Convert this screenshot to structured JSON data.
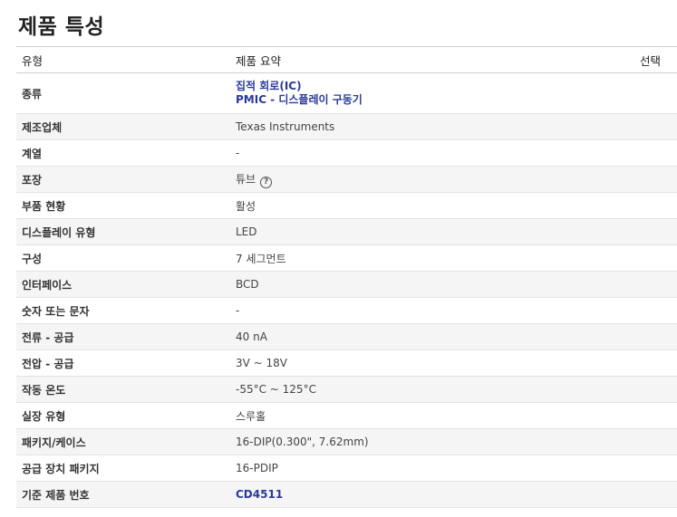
{
  "title": "제품 특성",
  "header": {
    "type": "유형",
    "summary": "제품 요약",
    "select": "선택"
  },
  "rows": [
    {
      "label": "종류",
      "value": "",
      "links": [
        "집적 회로(IC)",
        "PMIC - 디스플레이 구동기"
      ]
    },
    {
      "label": "제조업체",
      "value": "Texas Instruments"
    },
    {
      "label": "계열",
      "value": "-"
    },
    {
      "label": "포장",
      "value": "튜브",
      "help": "?"
    },
    {
      "label": "부품 현황",
      "value": "활성"
    },
    {
      "label": "디스플레이 유형",
      "value": "LED"
    },
    {
      "label": "구성",
      "value": "7 세그먼트"
    },
    {
      "label": "인터페이스",
      "value": "BCD"
    },
    {
      "label": "숫자 또는 문자",
      "value": "-"
    },
    {
      "label": "전류 - 공급",
      "value": "40 nA"
    },
    {
      "label": "전압 - 공급",
      "value": "3V ~ 18V"
    },
    {
      "label": "작동 온도",
      "value": "-55°C ~ 125°C"
    },
    {
      "label": "실장 유형",
      "value": "스루홀"
    },
    {
      "label": "패키지/케이스",
      "value": "16-DIP(0.300\", 7.62mm)"
    },
    {
      "label": "공급 장치 패키지",
      "value": "16-PDIP"
    },
    {
      "label": "기준 제품 번호",
      "value": "",
      "links": [
        "CD4511"
      ]
    }
  ]
}
